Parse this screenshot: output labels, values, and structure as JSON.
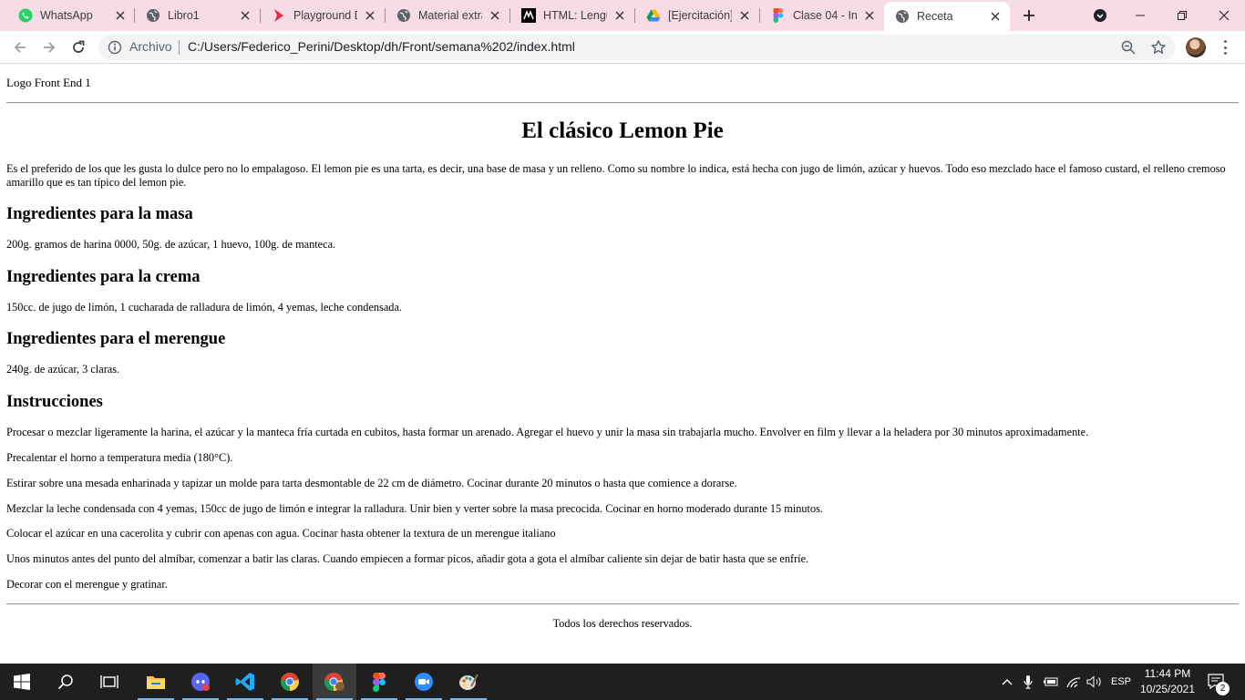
{
  "browser": {
    "tabs": [
      {
        "title": "WhatsApp",
        "icon": "whatsapp-icon"
      },
      {
        "title": "Libro1",
        "icon": "globe-icon"
      },
      {
        "title": "Playground D",
        "icon": "playground-icon"
      },
      {
        "title": "Material extra",
        "icon": "globe-icon"
      },
      {
        "title": "HTML: Lengu",
        "icon": "mdn-icon"
      },
      {
        "title": "[Ejercitación]",
        "icon": "drive-icon"
      },
      {
        "title": "Clase 04 - Int",
        "icon": "figma-icon"
      },
      {
        "title": "Receta",
        "icon": "globe-icon",
        "active": true
      }
    ],
    "address": {
      "scheme_label": "Archivo",
      "url": "C:/Users/Federico_Perini/Desktop/dh/Front/semana%202/index.html"
    }
  },
  "page": {
    "logo": "Logo Front End 1",
    "title": "El clásico Lemon Pie",
    "intro": "Es el preferido de los que les gusta lo dulce pero no lo empalagoso. El lemon pie es una tarta, es decir, una base de masa y un relleno. Como su nombre lo indica, está hecha con jugo de limón, azúcar y huevos. Todo eso mezclado hace el famoso custard, el relleno cremoso amarillo que es tan típico del lemon pie.",
    "sections": [
      {
        "heading": "Ingredientes para la masa",
        "text": "200g. gramos de harina 0000, 50g. de azúcar, 1 huevo, 100g. de manteca."
      },
      {
        "heading": "Ingredientes para la crema",
        "text": "150cc. de jugo de limón, 1 cucharada de ralladura de limón, 4 yemas, leche condensada."
      },
      {
        "heading": "Ingredientes para el merengue",
        "text": "240g. de azúcar, 3 claras."
      }
    ],
    "instructions": {
      "heading": "Instrucciones",
      "steps": [
        "Procesar o mezclar ligeramente la harina, el azúcar y la manteca fría curtada en cubitos, hasta formar un arenado. Agregar el huevo y unir la masa sin trabajarla mucho. Envolver en film y llevar a la heladera por 30 minutos aproximadamente.",
        "Precalentar el horno a temperatura media (180°C).",
        "Estirar sobre una mesada enharinada y tapizar un molde para tarta desmontable de 22 cm de diámetro. Cocinar durante 20 minutos o hasta que comience a dorarse.",
        "Mezclar la leche condensada con 4 yemas, 150cc de jugo de limón e integrar la ralladura. Unir bien y verter sobre la masa precocida. Cocinar en horno moderado durante 15 minutos.",
        "Colocar el azúcar en una cacerolita y cubrir con apenas con agua. Cocinar hasta obtener la textura de un merengue italiano",
        "Unos minutos antes del punto del almíbar, comenzar a batir las claras. Cuando empiecen a formar picos, añadir gota a gota el almíbar caliente sin dejar de batir hasta que se enfríe.",
        "Decorar con el merengue y gratinar."
      ]
    },
    "footer": "Todos los derechos reservados."
  },
  "taskbar": {
    "language": "ESP",
    "time": "11:44 PM",
    "date": "10/25/2021",
    "notifications": "2",
    "apps": [
      "start-icon",
      "search-icon",
      "task-view-icon",
      "file-explorer-icon",
      "discord-icon",
      "vscode-icon",
      "chrome-icon",
      "chrome-profile-icon",
      "figma-icon",
      "zoom-icon",
      "paint-icon"
    ]
  }
}
